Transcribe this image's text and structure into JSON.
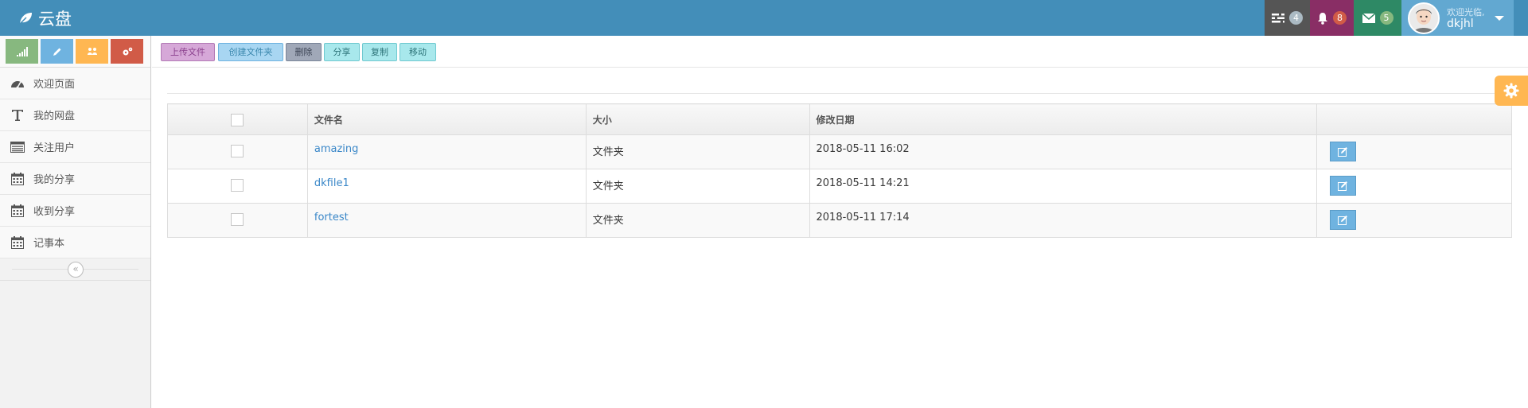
{
  "app": {
    "brand": "云盘"
  },
  "navbar": {
    "tasks_count": "4",
    "notifications_count": "8",
    "messages_count": "5",
    "user_welcome": "欢迎光临,",
    "user_name": "dkjhl"
  },
  "sidebar": {
    "items": [
      {
        "label": "欢迎页面",
        "icon": "dashboard-icon"
      },
      {
        "label": "我的网盘",
        "icon": "text-icon"
      },
      {
        "label": "关注用户",
        "icon": "list-icon"
      },
      {
        "label": "我的分享",
        "icon": "calendar-icon"
      },
      {
        "label": "收到分享",
        "icon": "calendar-icon"
      },
      {
        "label": "记事本",
        "icon": "calendar-icon"
      }
    ]
  },
  "toolbar": {
    "upload": "上传文件",
    "mkdir": "创建文件夹",
    "delete": "删除",
    "share": "分享",
    "copy": "复制",
    "move": "移动"
  },
  "table": {
    "headers": [
      "文件名",
      "大小",
      "修改日期"
    ],
    "rows": [
      {
        "name": "amazing",
        "size": "文件夹",
        "date": "2018-05-11 16:02"
      },
      {
        "name": "dkfile1",
        "size": "文件夹",
        "date": "2018-05-11 14:21"
      },
      {
        "name": "fortest",
        "size": "文件夹",
        "date": "2018-05-11 17:14"
      }
    ]
  },
  "colors": {
    "navbar": "#438eb9",
    "link": "#3a87c8",
    "settings": "#ffb752"
  }
}
